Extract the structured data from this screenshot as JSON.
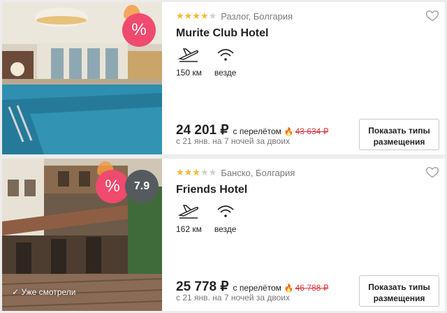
{
  "hotels": [
    {
      "stars": 4,
      "location": "Разлог, Болгария",
      "name": "Murite Club Hotel",
      "sale_symbol": "%",
      "rating": "",
      "distance": "150 км",
      "wifi": "везде",
      "price": "24 201 ₽",
      "with_flight": "с перелётом",
      "old_price": "43 634 ₽",
      "dates": "с 21 янв. на 7 ночей за двоих",
      "button": "Показать типы размещения",
      "seen_label": ""
    },
    {
      "stars": 3,
      "location": "Банско, Болгария",
      "name": "Friends Hotel",
      "sale_symbol": "%",
      "rating": "7.9",
      "distance": "162 км",
      "wifi": "везде",
      "price": "25 778 ₽",
      "with_flight": "с перелётом",
      "old_price": "46 788 ₽",
      "dates": "с 21 янв. на 7 ночей за двоих",
      "button": "Показать типы размещения",
      "seen_label": "✓ Уже смотрели"
    }
  ],
  "icons": {
    "plane": "plane-icon",
    "wifi": "wifi-icon",
    "heart": "heart-icon",
    "fire": "fire-icon",
    "sale": "sale-badge-icon"
  },
  "colors": {
    "star": "#f7b731",
    "sale": "#f04a6e",
    "old_price": "#e0383e",
    "rating_badge": "#555a5e"
  }
}
